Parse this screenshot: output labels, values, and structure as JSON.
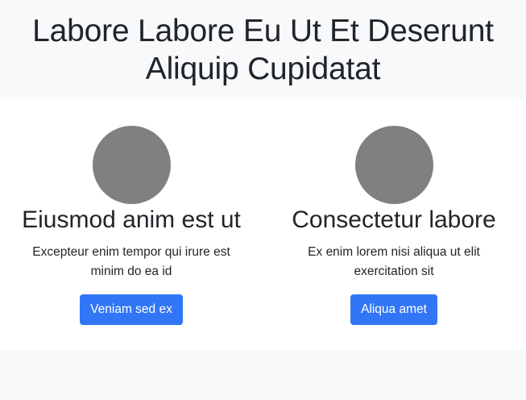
{
  "header": {
    "title": "Labore Labore Eu Ut Et Deserunt Aliquip Cupidatat"
  },
  "features": [
    {
      "heading": "Eiusmod anim est ut",
      "text": "Excepteur enim tempor qui irure est minim do ea id",
      "button_label": "Veniam sed ex"
    },
    {
      "heading": "Consectetur labore",
      "text": "Ex enim lorem nisi aliqua ut elit exercitation sit",
      "button_label": "Aliqua amet"
    }
  ],
  "colors": {
    "header_bg": "#f8f9fa",
    "avatar": "#808080",
    "button": "#3176f6",
    "text": "#212529"
  }
}
